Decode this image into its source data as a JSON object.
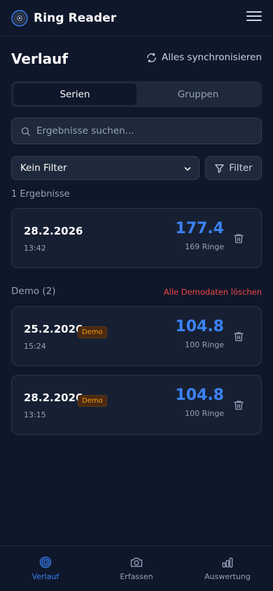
{
  "header": {
    "title": "Ring Reader"
  },
  "page": {
    "title": "Verlauf",
    "sync_label": "Alles synchronisieren"
  },
  "tabs": [
    {
      "label": "Serien",
      "active": true
    },
    {
      "label": "Gruppen",
      "active": false
    }
  ],
  "search": {
    "placeholder": "Ergebnisse suchen...",
    "value": ""
  },
  "filter": {
    "selected": "Kein Filter",
    "button_label": "Filter"
  },
  "results": {
    "count_label": "1 Ergebnisse",
    "items": [
      {
        "date": "28.2.2026",
        "time": "13:42",
        "score": "177.4",
        "rings": "169 Ringe"
      }
    ]
  },
  "demo": {
    "title": "Demo (2)",
    "clear_label": "Alle Demodaten löschen",
    "items": [
      {
        "date": "25.2.2026",
        "badge": "Demo",
        "time": "15:24",
        "score": "104.8",
        "rings": "100 Ringe"
      },
      {
        "date": "28.2.2026",
        "badge": "Demo",
        "time": "13:15",
        "score": "104.8",
        "rings": "100 Ringe"
      }
    ]
  },
  "nav": [
    {
      "label": "Verlauf",
      "icon": "target-icon",
      "active": true
    },
    {
      "label": "Erfassen",
      "icon": "camera-icon",
      "active": false
    },
    {
      "label": "Auswertung",
      "icon": "bar-chart-icon",
      "active": false
    }
  ],
  "colors": {
    "background": "#0f172a",
    "accent": "#3b82f6",
    "danger": "#ef4444",
    "badge": "#f59e0b"
  }
}
